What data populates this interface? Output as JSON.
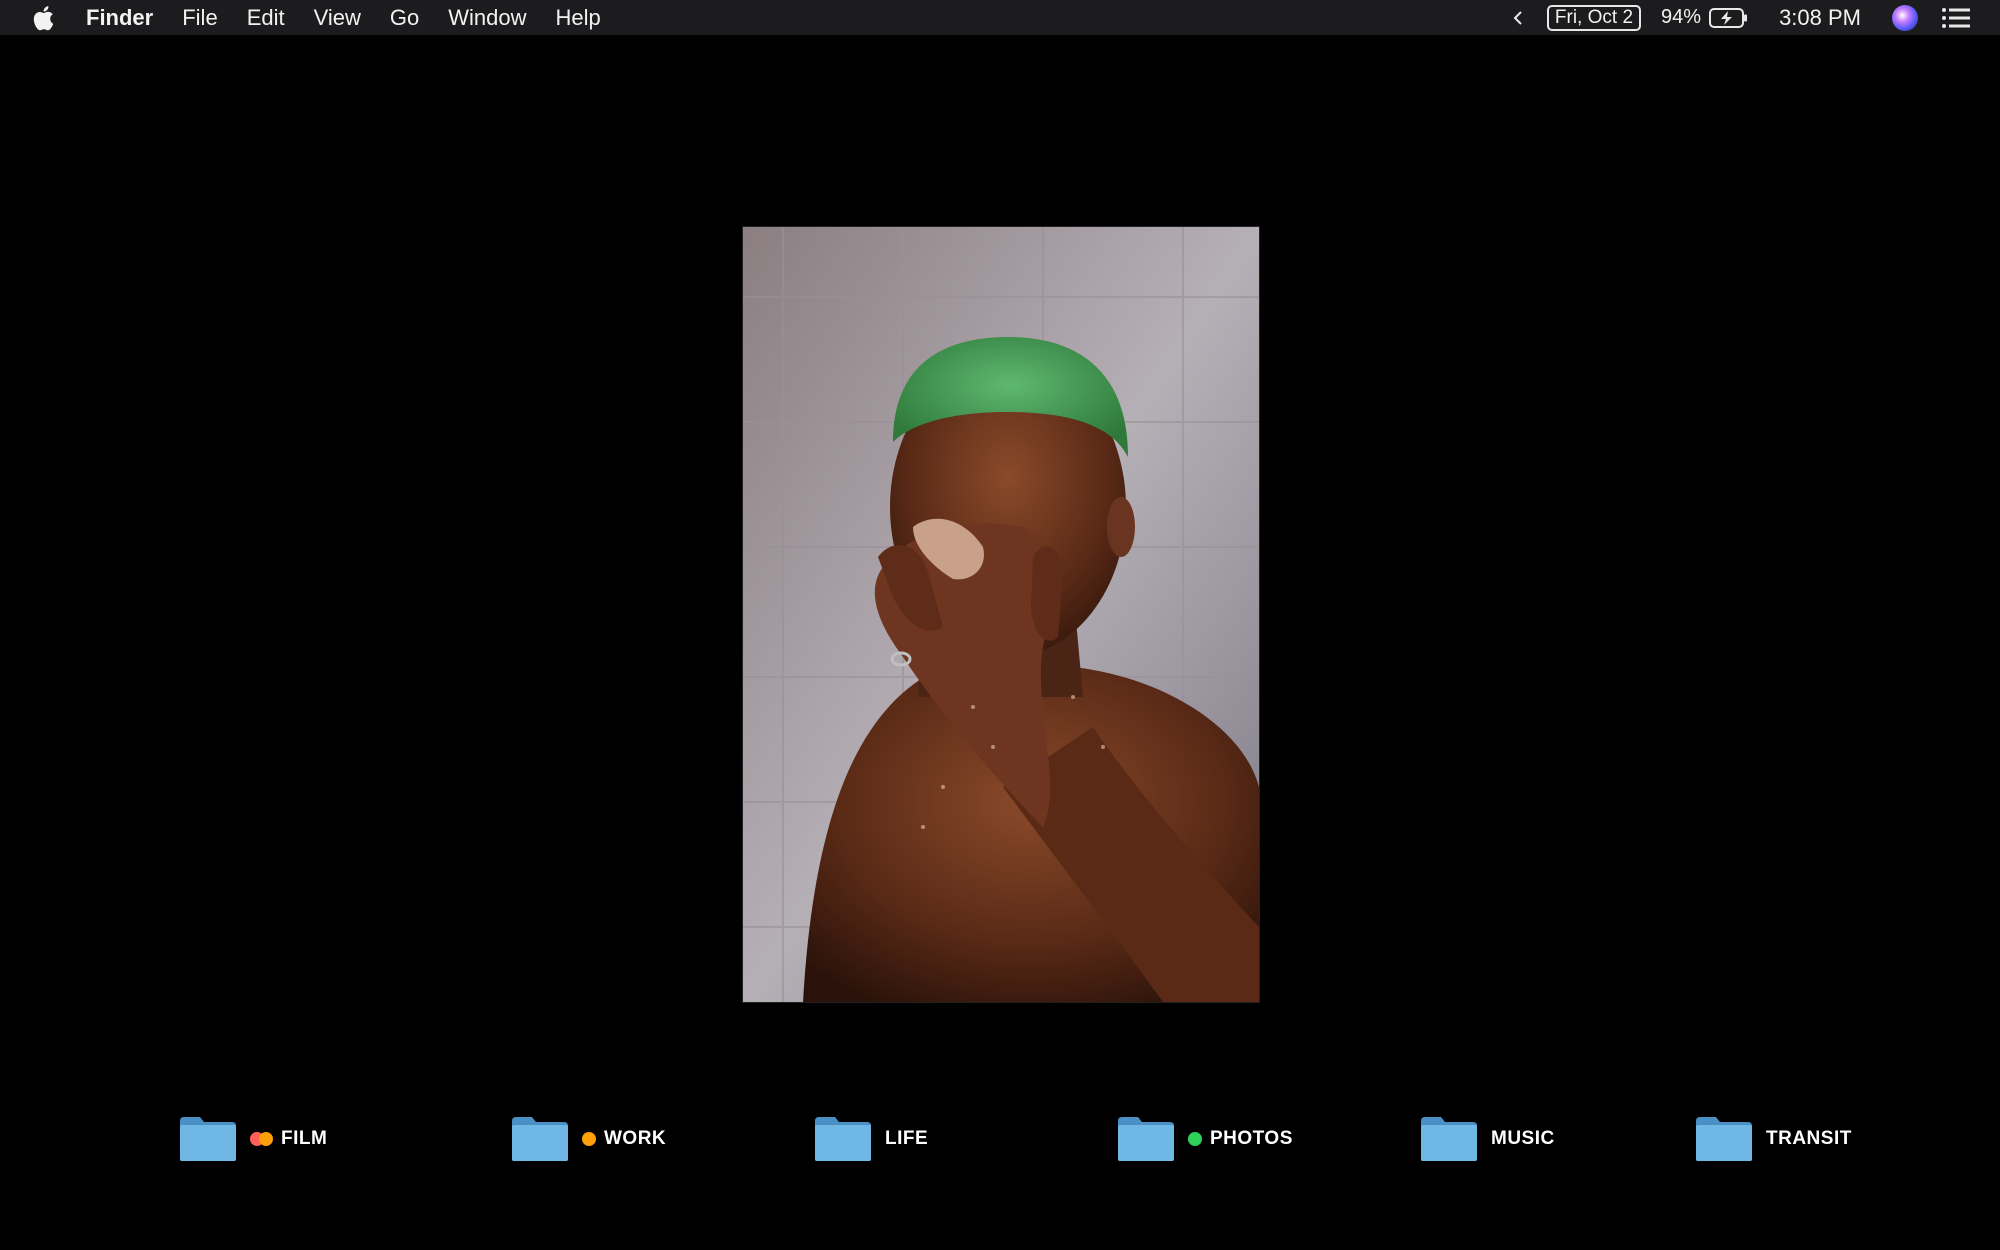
{
  "menubar": {
    "apple_icon": "apple-logo-icon",
    "app_name": "Finder",
    "menus": [
      "File",
      "Edit",
      "View",
      "Go",
      "Window",
      "Help"
    ],
    "date": "Fri, Oct 2",
    "battery_percent": "94%",
    "battery_charging": true,
    "time": "3:08 PM"
  },
  "desktop": {
    "folders": [
      {
        "label": "FILM",
        "tags": [
          "#ff5f57",
          "#ff9f0a"
        ]
      },
      {
        "label": "WORK",
        "tags": [
          "#ff9f0a"
        ]
      },
      {
        "label": "LIFE",
        "tags": []
      },
      {
        "label": "PHOTOS",
        "tags": [
          "#30d158"
        ]
      },
      {
        "label": "MUSIC",
        "tags": []
      },
      {
        "label": "TRANSIT",
        "tags": []
      }
    ]
  },
  "colors": {
    "menubar_bg": "#1c1c1e",
    "desktop_bg": "#000000",
    "folder_blue": "#6fb8e6"
  }
}
